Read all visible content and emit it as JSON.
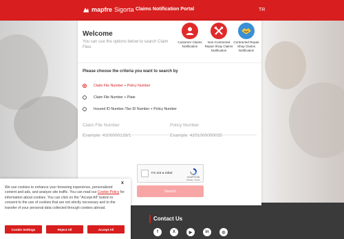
{
  "header": {
    "brand_main": "mapfre",
    "brand_sub": "Sigorta",
    "portal_title": "Claims Notification Portal",
    "language": "TR"
  },
  "welcome": {
    "title": "Welcome",
    "subtitle": "You can use the options below to search Claim Files"
  },
  "options": [
    {
      "label": "Customer Claims Notification",
      "icon": "customer-claim-icon",
      "color": "#e02a2a"
    },
    {
      "label": "Non-Contracted Repair Shop Claims Notification",
      "icon": "repair-tools-icon",
      "color": "#e02a2a"
    },
    {
      "label": "Contracted Repair Shop Claims Notification",
      "icon": "handshake-icon",
      "color": "#3a8fd6"
    }
  ],
  "criteria": {
    "title": "Please choose the criteria you want to search by",
    "items": [
      {
        "label": "Claim File Number + Policy Number",
        "selected": true
      },
      {
        "label": "Claim File Number + Plate",
        "selected": false
      },
      {
        "label": "Insured ID Number /Tax ID Number + Policy Number",
        "selected": false
      }
    ]
  },
  "fields": {
    "claim_label": "Claim File Number",
    "claim_placeholder": "Example. 4100000128/1",
    "policy_label": "Policy Number",
    "policy_placeholder": "Example. 4201000000035"
  },
  "captcha": {
    "label": "I'm not a robot",
    "brand": "reCAPTCHA",
    "links": "Privacy - Terms"
  },
  "search_button": "Search",
  "footer": {
    "contact_title": "Contact Us",
    "social": [
      {
        "icon": "facebook-icon",
        "glyph": "f"
      },
      {
        "icon": "x-icon",
        "glyph": "X"
      },
      {
        "icon": "youtube-icon",
        "glyph": "▶"
      },
      {
        "icon": "linkedin-icon",
        "glyph": "in"
      },
      {
        "icon": "instagram-icon",
        "glyph": "◎"
      }
    ]
  },
  "cookie": {
    "text_1": "We use cookies to enhance your browsing experience, personalized content and ads, and analyze site traffic. You can read our ",
    "link": "Cookie Policy",
    "text_2": " for information about cookies.  You can click on the \"Accept All\" button to consent to the use of cookies that are not strictly necessary and to the transfer of your personal data collected through cookies abroad.",
    "close": "x",
    "settings_button": "Cookie Settings",
    "reject_button": "Reject All",
    "accept_button": "Accept All"
  },
  "colors": {
    "brand_red": "#d81e1e",
    "search_button_disabled": "#f8a5a5",
    "footer": "#3a3a3a"
  }
}
